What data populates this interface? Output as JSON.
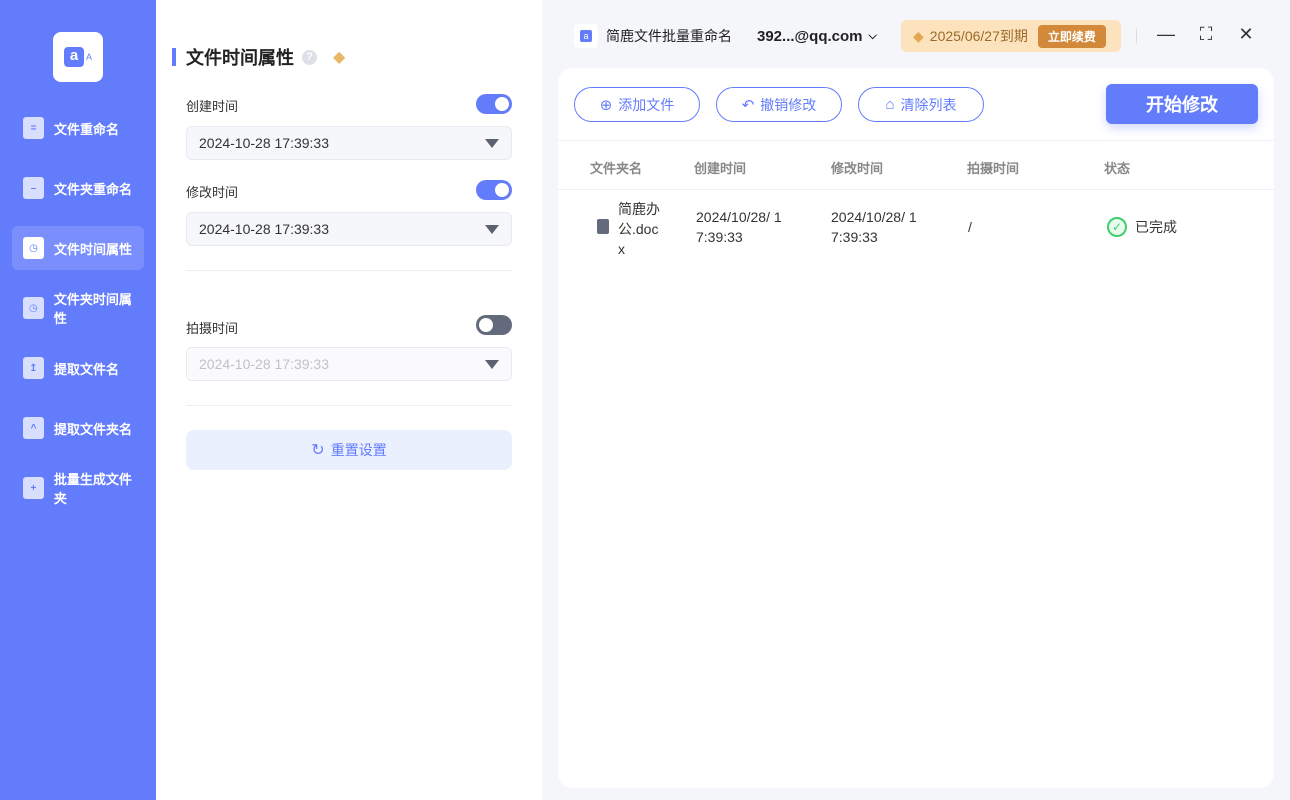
{
  "sidebar": {
    "items": [
      {
        "label": "文件重命名"
      },
      {
        "label": "文件夹重命名"
      },
      {
        "label": "文件时间属性"
      },
      {
        "label": "文件夹时间属性"
      },
      {
        "label": "提取文件名"
      },
      {
        "label": "提取文件夹名"
      },
      {
        "label": "批量生成文件夹"
      }
    ]
  },
  "panel": {
    "title": "文件时间属性",
    "help": "?",
    "fields": [
      {
        "label": "创建时间",
        "value": "2024-10-28 17:39:33",
        "enabled": true
      },
      {
        "label": "修改时间",
        "value": "2024-10-28 17:39:33",
        "enabled": true
      },
      {
        "label": "拍摄时间",
        "value": "2024-10-28 17:39:33",
        "enabled": false
      }
    ],
    "reset": "重置设置"
  },
  "header": {
    "app_name": "简鹿文件批量重命名",
    "account": "392...@qq.com",
    "vip_expiry": "2025/06/27到期",
    "renew": "立即续费"
  },
  "toolbar": {
    "add": "添加文件",
    "undo": "撤销修改",
    "clear": "清除列表",
    "start": "开始修改"
  },
  "table": {
    "headers": [
      "文件夹名",
      "创建时间",
      "修改时间",
      "拍摄时间",
      "状态"
    ],
    "rows": [
      {
        "name_l1": "简鹿办",
        "name_l2": "公.doc",
        "name_l3": "x",
        "created_l1": "2024/10/28/ 1",
        "created_l2": "7:39:33",
        "modified_l1": "2024/10/28/ 1",
        "modified_l2": "7:39:33",
        "shot": "/",
        "status": "已完成"
      }
    ]
  },
  "colors": {
    "accent": "#637cfc",
    "success": "#3ccf6b"
  }
}
